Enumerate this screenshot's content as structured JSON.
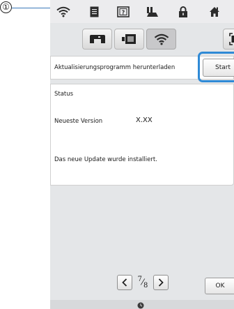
{
  "callout": {
    "number": "①"
  },
  "status_bar": {
    "icons": [
      "wifi-icon",
      "document-icon",
      "help-icon",
      "foot-pedal-icon",
      "lock-icon",
      "home-icon"
    ]
  },
  "tabs": {
    "items": [
      "sewing-machine-icon",
      "card-reader-icon",
      "wifi-icon"
    ],
    "active": "wifi-icon"
  },
  "side_button": {
    "icon": "capture-icon"
  },
  "update_row": {
    "label": "Aktualisierungsprogramm herunterladen",
    "button": "Start"
  },
  "status": {
    "heading": "Status",
    "version_label": "Neueste Version",
    "version_value": "X.XX",
    "message": "Das neue Update wurde installiert."
  },
  "pager": {
    "current": "7",
    "total": "8"
  },
  "ok_button": "OK",
  "bottom_bar": {
    "icon": "clock-icon"
  },
  "colors": {
    "highlight": "#2f8ad6",
    "callout_line": "#3a78b8",
    "screen_background": "#e4e6e8"
  }
}
